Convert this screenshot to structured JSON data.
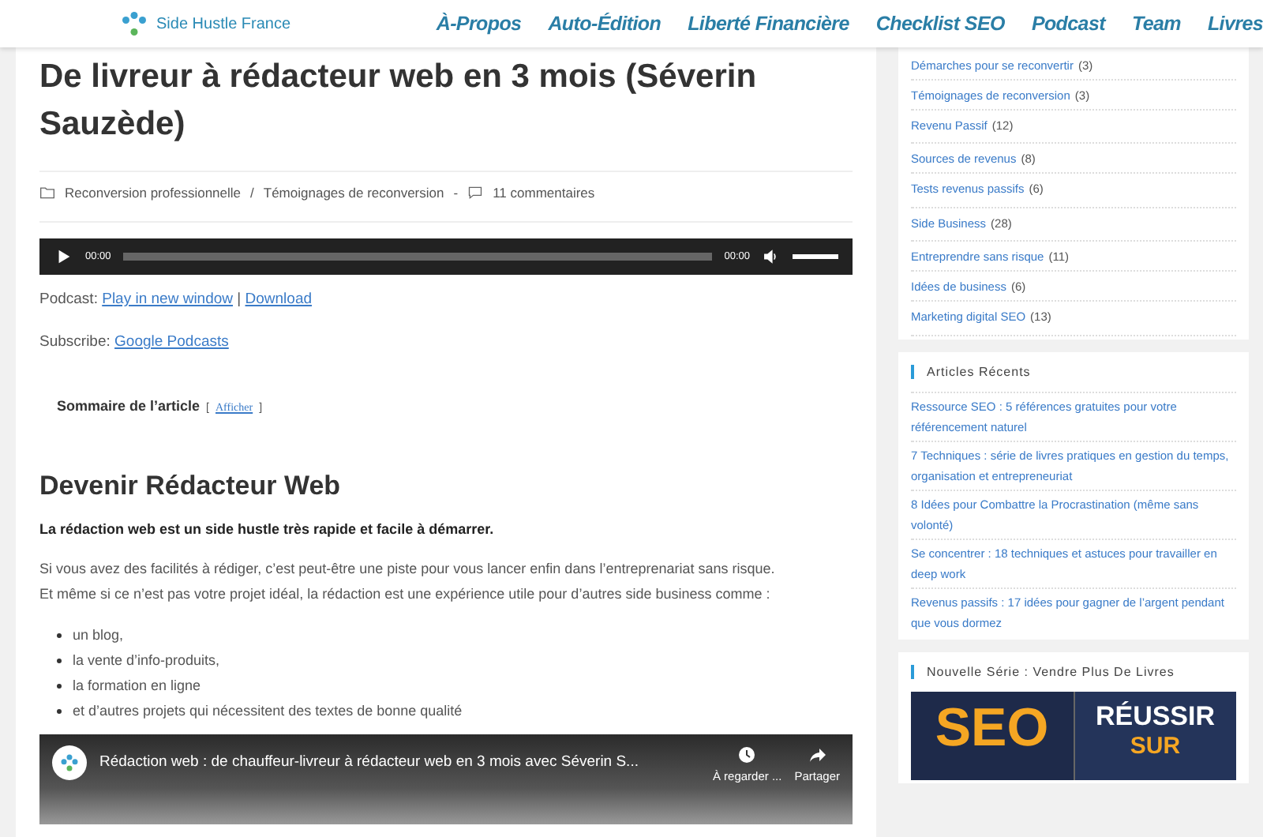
{
  "header": {
    "logo_text": "Side Hustle France",
    "nav": [
      {
        "label": "À-Propos"
      },
      {
        "label": "Auto-Édition"
      },
      {
        "label": "Liberté Financière"
      },
      {
        "label": "Checklist SEO"
      },
      {
        "label": "Podcast"
      },
      {
        "label": "Team"
      },
      {
        "label": "Livres"
      }
    ]
  },
  "article": {
    "title": "De livreur à rédacteur web en 3 mois (Séverin Sauzède)",
    "meta": {
      "categories": [
        "Reconversion professionnelle",
        "Témoignages de reconversion"
      ],
      "separator": "/",
      "dash": "-",
      "comments": "11 commentaires"
    },
    "player": {
      "time": "00:00",
      "duration": "00:00",
      "volume": {
        "level": 1
      }
    },
    "podcast_line": {
      "label": "Podcast:",
      "links": [
        "Play in new window",
        "Download"
      ],
      "separator": "|"
    },
    "subscribe_line": {
      "label": "Subscribe:",
      "link": "Google Podcasts"
    },
    "toc": {
      "title": "Sommaire de l’article",
      "open": "[",
      "toggle": "Afficher",
      "close": "]"
    },
    "heading": "Devenir Rédacteur Web",
    "lead": "La rédaction web est un side hustle très rapide et facile à démarrer.",
    "paragraph": [
      "Si vous avez des facilités à rédiger, c’est peut-être une piste pour vous lancer enfin dans l’entreprenariat sans risque.",
      "Et même si ce n’est pas votre projet idéal, la rédaction est une expérience utile pour d’autres side business comme :"
    ],
    "bullets": [
      "un blog,",
      "la vente d’info-produits,",
      "la formation en ligne",
      "et d’autres projets qui nécessitent des textes de bonne qualité"
    ],
    "video": {
      "title": "Rédaction web : de chauffeur-livreur à rédacteur web en 3 mois avec Séverin S...",
      "actions": [
        {
          "kind": "clock",
          "label": "À regarder ..."
        },
        {
          "kind": "share",
          "label": "Partager"
        }
      ]
    }
  },
  "sidebar": {
    "categories": [
      {
        "label": "Démarches pour se reconvertir",
        "count": "(3)"
      },
      {
        "label": "Témoignages de reconversion",
        "count": "(3)"
      },
      {
        "label": "Revenu Passif",
        "count": "(12)",
        "children": [
          {
            "label": "Sources de revenus",
            "count": "(8)"
          },
          {
            "label": "Tests revenus passifs",
            "count": "(6)"
          }
        ]
      },
      {
        "label": "Side Business",
        "count": "(28)",
        "children": [
          {
            "label": "Entreprendre sans risque",
            "count": "(11)"
          },
          {
            "label": "Idées de business",
            "count": "(6)"
          },
          {
            "label": "Marketing digital SEO",
            "count": "(13)"
          }
        ]
      }
    ],
    "recent": {
      "title": "Articles Récents",
      "items": [
        "Ressource SEO : 5 références gratuites pour votre référencement naturel",
        "7 Techniques : série de livres pratiques en gestion du temps, organisation et entrepreneuriat",
        "8 Idées pour Combattre la Procrastination (même sans volonté)",
        "Se concentrer : 18 techniques et astuces pour travailler en deep work",
        "Revenus passifs : 17 idées pour gagner de l’argent pendant que vous dormez"
      ]
    },
    "series": {
      "title": "Nouvelle Série : Vendre Plus De Livres",
      "banner": {
        "left": "SEO",
        "right": [
          "RÉUSSIR",
          "SUR"
        ]
      }
    }
  }
}
